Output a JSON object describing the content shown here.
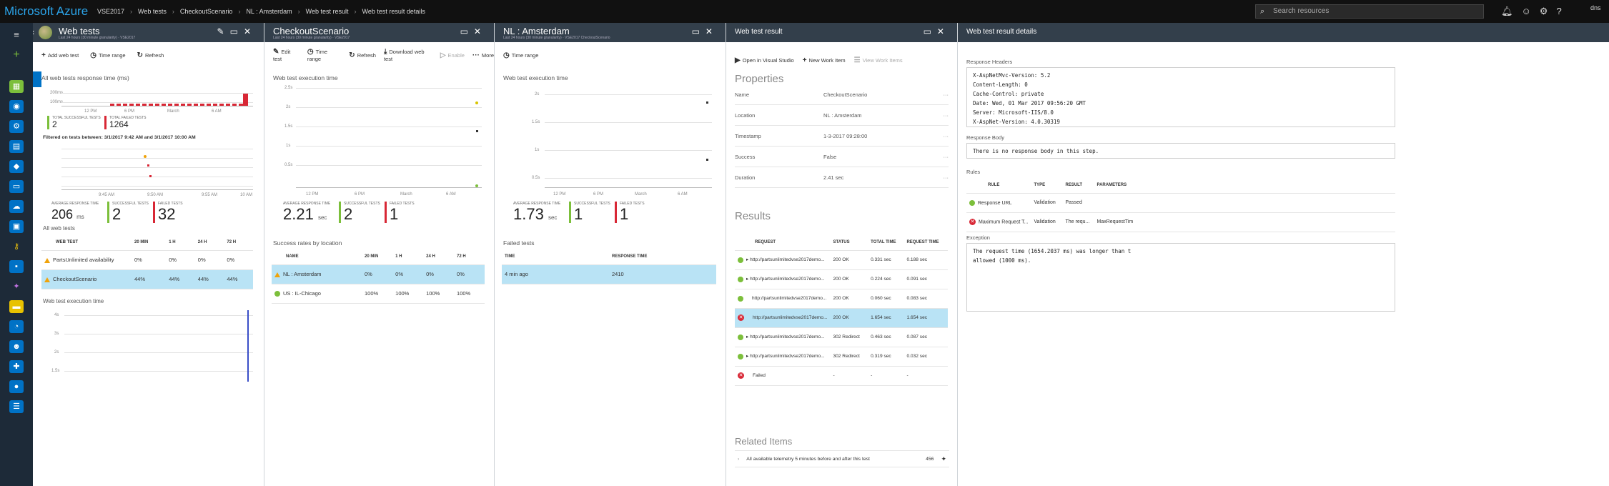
{
  "topbar": {
    "brand": "Microsoft Azure",
    "crumbs": [
      "VSE2017",
      "Web tests",
      "CheckoutScenario",
      "NL : Amsterdam",
      "Web test result",
      "Web test result details"
    ],
    "search_placeholder": "Search resources",
    "user": "dns"
  },
  "nav": {
    "items": [
      "menu-icon",
      "plus-icon",
      "dashboard-icon",
      "globe-icon",
      "gear-icon",
      "database-icon",
      "cube-icon",
      "monitor-icon",
      "cloud-icon",
      "key-icon",
      "briefcase-icon",
      "pin-icon",
      "card-icon",
      "chart-icon",
      "people-icon",
      "puzzle-icon",
      "circle-icon",
      "list-icon"
    ]
  },
  "colors": {
    "success": "#7cbf3b",
    "failure": "#d82735",
    "warning": "#f0a30a",
    "selected": "#b9e3f5",
    "header": "#333f4b",
    "brand": "#2ba3e8"
  },
  "blade1": {
    "title": "Web tests",
    "subtitle": "Last 24 hours (30 minute granularity) · VSE2017",
    "toolbar": [
      "Add web test",
      "Time range",
      "Refresh"
    ],
    "chart1_title": "All web tests response time (ms)",
    "chart1_ticks": [
      "200ms",
      "100ms"
    ],
    "chart1_xticks": [
      "12 PM",
      "6 PM",
      "March",
      "6 AM"
    ],
    "total_success_label": "TOTAL SUCCESSFUL TESTS",
    "total_success": "2",
    "total_failed_label": "TOTAL FAILED TESTS",
    "total_failed": "1264",
    "filtered_text": "Filtered on tests between: 3/1/2017 9:42 AM and 3/1/2017 10:00 AM",
    "chart2_xticks": [
      "9:45 AM",
      "9:50 AM",
      "9:55 AM",
      "10:00 AM",
      "10 AM"
    ],
    "avg_label": "AVERAGE RESPONSE TIME",
    "avg_value": "206",
    "avg_unit": "ms",
    "succ_label": "SUCCESSFUL TESTS",
    "succ": "2",
    "fail_label": "FAILED TESTS",
    "fail": "32",
    "table_title": "All web tests",
    "table_headers": [
      "WEB TEST",
      "20 MIN",
      "1 H",
      "24 H",
      "72 H"
    ],
    "rows": [
      [
        "PartsUnlimited availability",
        "0%",
        "0%",
        "0%",
        "0%"
      ],
      [
        "CheckoutScenario",
        "44%",
        "44%",
        "44%",
        "44%"
      ]
    ],
    "exec_title": "Web test execution time",
    "exec_ticks": [
      "4s",
      "3s",
      "2s",
      "1.5s"
    ]
  },
  "blade2": {
    "title": "CheckoutScenario",
    "subtitle": "Last 24 hours (30 minute granularity) · VSE2017",
    "toolbar": [
      "Edit test",
      "Time range",
      "Refresh",
      "Download web test",
      "Enable",
      "More"
    ],
    "chart_title": "Web test execution time",
    "ticks": [
      "2.5s",
      "2s",
      "1.5s",
      "1s",
      "0.5s"
    ],
    "xticks": [
      "12 PM",
      "6 PM",
      "March",
      "6 AM"
    ],
    "avg_label": "AVERAGE RESPONSE TIME",
    "avg_value": "2.21",
    "avg_unit": "sec",
    "succ_label": "SUCCESSFUL TESTS",
    "succ": "2",
    "fail_label": "FAILED TESTS",
    "fail": "1",
    "table_title": "Success rates by location",
    "table_headers": [
      "NAME",
      "20 MIN",
      "1 H",
      "24 H",
      "72 H"
    ],
    "rows": [
      [
        "NL : Amsterdam",
        "0%",
        "0%",
        "0%",
        "0%"
      ],
      [
        "US : IL-Chicago",
        "100%",
        "100%",
        "100%",
        "100%"
      ]
    ]
  },
  "blade3": {
    "title": "NL : Amsterdam",
    "subtitle": "Last 24 hours (30 minute granularity) · VSE2017 CheckoutScenario",
    "toolbar": [
      "Time range"
    ],
    "chart_title": "Web test execution time",
    "ticks": [
      "2s",
      "1.5s",
      "1s",
      "0.5s"
    ],
    "xticks": [
      "12 PM",
      "6 PM",
      "March",
      "6 AM"
    ],
    "avg_label": "AVERAGE RESPONSE TIME",
    "avg_value": "1.73",
    "avg_unit": "sec",
    "succ_label": "SUCCESSFUL TESTS",
    "succ": "1",
    "fail_label": "FAILED TESTS",
    "fail": "1",
    "table_title": "Failed tests",
    "table_headers": [
      "TIME",
      "RESPONSE TIME"
    ],
    "rows": [
      [
        "4 min ago",
        "2410"
      ]
    ]
  },
  "blade4": {
    "title": "Web test result",
    "toolbar": [
      "Open in Visual Studio",
      "New Work Item",
      "View Work Items"
    ],
    "props_title": "Properties",
    "props": [
      [
        "Name",
        "CheckoutScenario"
      ],
      [
        "Location",
        "NL : Amsterdam"
      ],
      [
        "Timestamp",
        "1-3-2017 09:28:00"
      ],
      [
        "Success",
        "False"
      ],
      [
        "Duration",
        "2.41 sec"
      ]
    ],
    "results_title": "Results",
    "results_headers": [
      "REQUEST",
      "STATUS",
      "TOTAL TIME",
      "REQUEST TIME"
    ],
    "results": [
      [
        "ok",
        "http://partsunlimitedvse2017demo...",
        "200 OK",
        "0.331 sec",
        "0.188 sec"
      ],
      [
        "ok",
        "http://partsunlimitedvse2017demo...",
        "200 OK",
        "0.224 sec",
        "0.091 sec"
      ],
      [
        "ok",
        "http://partsunlimitedvse2017demo...",
        "200 OK",
        "0.060 sec",
        "0.083 sec"
      ],
      [
        "err",
        "http://partsunlimitedvse2017demo...",
        "200 OK",
        "1.654 sec",
        "1.654 sec"
      ],
      [
        "ok",
        "http://partsunlimitedvse2017demo...",
        "302 Redirect",
        "0.463 sec",
        "0.087 sec"
      ],
      [
        "ok",
        "http://partsunlimitedvse2017demo...",
        "302 Redirect",
        "0.319 sec",
        "0.032 sec"
      ],
      [
        "err",
        "Failed",
        "-",
        "-",
        "-"
      ]
    ],
    "related_title": "Related Items",
    "related_text": "All available telemetry 5 minutes before and after this test",
    "related_count": "456"
  },
  "blade5": {
    "title": "Web test result details",
    "resp_headers_title": "Response Headers",
    "resp_headers": "X-AspNetMvc-Version: 5.2\nContent-Length: 0\nCache-Control: private\nDate: Wed, 01 Mar 2017 09:56:20 GMT\nServer: Microsoft-IIS/8.0\nX-AspNet-Version: 4.0.30319",
    "resp_body_title": "Response Body",
    "resp_body": "There is no response body in this step.",
    "rules_title": "Rules",
    "rules_headers": [
      "RULE",
      "TYPE",
      "RESULT",
      "PARAMETERS"
    ],
    "rules": [
      [
        "ok",
        "Response URL",
        "Validation",
        "Passed",
        ""
      ],
      [
        "err",
        "Maximum Request T...",
        "Validation",
        "The requ...",
        "MaxRequestTim"
      ]
    ],
    "exception_title": "Exception",
    "exception": "The request time (1654.2037 ms) was longer than t\nallowed (1000 ms)."
  }
}
